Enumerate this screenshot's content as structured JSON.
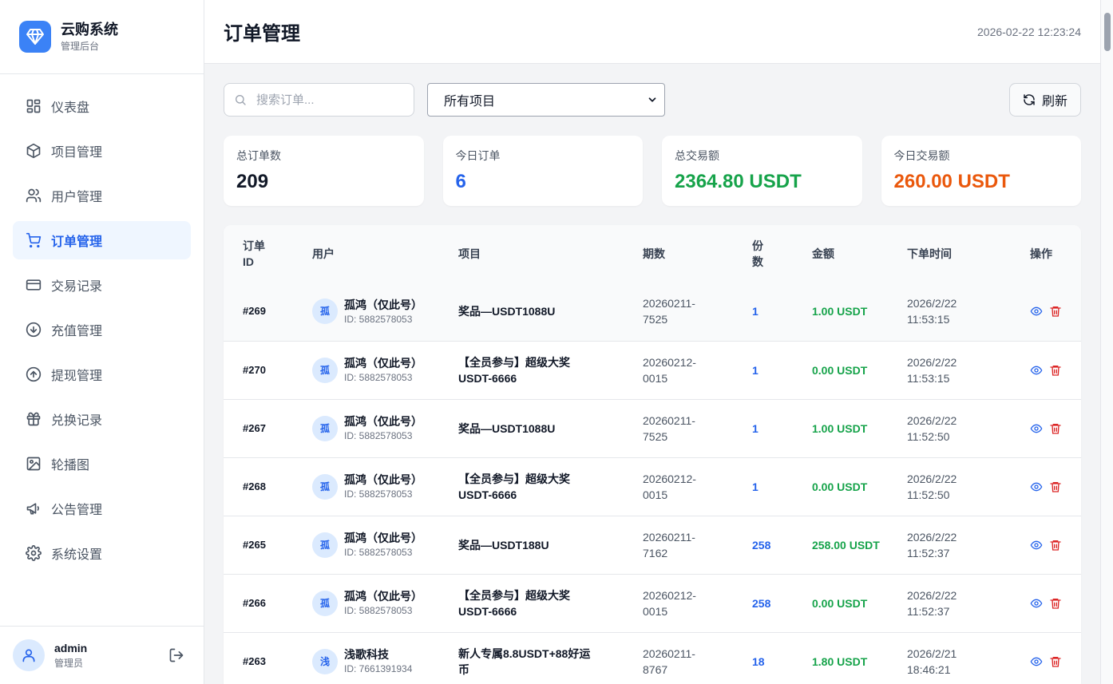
{
  "brand": {
    "title": "云购系统",
    "subtitle": "管理后台",
    "icon": "gem-icon"
  },
  "nav": [
    {
      "label": "仪表盘",
      "icon": "dashboard-icon",
      "active": false
    },
    {
      "label": "项目管理",
      "icon": "box-icon",
      "active": false
    },
    {
      "label": "用户管理",
      "icon": "users-icon",
      "active": false
    },
    {
      "label": "订单管理",
      "icon": "cart-icon",
      "active": true
    },
    {
      "label": "交易记录",
      "icon": "card-icon",
      "active": false
    },
    {
      "label": "充值管理",
      "icon": "arrow-down-circle-icon",
      "active": false
    },
    {
      "label": "提现管理",
      "icon": "arrow-up-circle-icon",
      "active": false
    },
    {
      "label": "兑换记录",
      "icon": "gift-icon",
      "active": false
    },
    {
      "label": "轮播图",
      "icon": "image-icon",
      "active": false
    },
    {
      "label": "公告管理",
      "icon": "megaphone-icon",
      "active": false
    },
    {
      "label": "系统设置",
      "icon": "gear-icon",
      "active": false
    }
  ],
  "user": {
    "name": "admin",
    "role": "管理员"
  },
  "header": {
    "title": "订单管理",
    "datetime": "2026-02-22 12:23:24"
  },
  "toolbar": {
    "search_placeholder": "搜索订单...",
    "select_value": "所有项目",
    "refresh_label": "刷新"
  },
  "stats": [
    {
      "label": "总订单数",
      "value": "209",
      "color": "#111827"
    },
    {
      "label": "今日订单",
      "value": "6",
      "color": "#2563eb"
    },
    {
      "label": "总交易额",
      "value": "2364.80 USDT",
      "color": "#16a34a"
    },
    {
      "label": "今日交易额",
      "value": "260.00 USDT",
      "color": "#ea580c"
    }
  ],
  "table": {
    "headers": {
      "id": "订单ID",
      "user": "用户",
      "project": "项目",
      "period": "期数",
      "qty": "份数",
      "amount": "金额",
      "time": "下单时间",
      "ops": "操作"
    },
    "rows": [
      {
        "id": "#269",
        "avatar": "孤",
        "user": "孤鸿（仅此号）",
        "uid": "ID: 5882578053",
        "project": "奖品—USDT1088U",
        "period": "20260211-7525",
        "qty": "1",
        "amount": "1.00 USDT",
        "time": "2026/2/22 11:53:15"
      },
      {
        "id": "#270",
        "avatar": "孤",
        "user": "孤鸿（仅此号）",
        "uid": "ID: 5882578053",
        "project": "【全员参与】超级大奖USDT-6666",
        "period": "20260212-0015",
        "qty": "1",
        "amount": "0.00 USDT",
        "time": "2026/2/22 11:53:15"
      },
      {
        "id": "#267",
        "avatar": "孤",
        "user": "孤鸿（仅此号）",
        "uid": "ID: 5882578053",
        "project": "奖品—USDT1088U",
        "period": "20260211-7525",
        "qty": "1",
        "amount": "1.00 USDT",
        "time": "2026/2/22 11:52:50"
      },
      {
        "id": "#268",
        "avatar": "孤",
        "user": "孤鸿（仅此号）",
        "uid": "ID: 5882578053",
        "project": "【全员参与】超级大奖USDT-6666",
        "period": "20260212-0015",
        "qty": "1",
        "amount": "0.00 USDT",
        "time": "2026/2/22 11:52:50"
      },
      {
        "id": "#265",
        "avatar": "孤",
        "user": "孤鸿（仅此号）",
        "uid": "ID: 5882578053",
        "project": "奖品—USDT188U",
        "period": "20260211-7162",
        "qty": "258",
        "amount": "258.00 USDT",
        "time": "2026/2/22 11:52:37"
      },
      {
        "id": "#266",
        "avatar": "孤",
        "user": "孤鸿（仅此号）",
        "uid": "ID: 5882578053",
        "project": "【全员参与】超级大奖USDT-6666",
        "period": "20260212-0015",
        "qty": "258",
        "amount": "0.00 USDT",
        "time": "2026/2/22 11:52:37"
      },
      {
        "id": "#263",
        "avatar": "浅",
        "user": "浅歌科技",
        "uid": "ID: 7661391934",
        "project": "新人专属8.8USDT+88好运币",
        "period": "20260211-8767",
        "qty": "18",
        "amount": "1.80 USDT",
        "time": "2026/2/21 18:46:21"
      }
    ]
  }
}
